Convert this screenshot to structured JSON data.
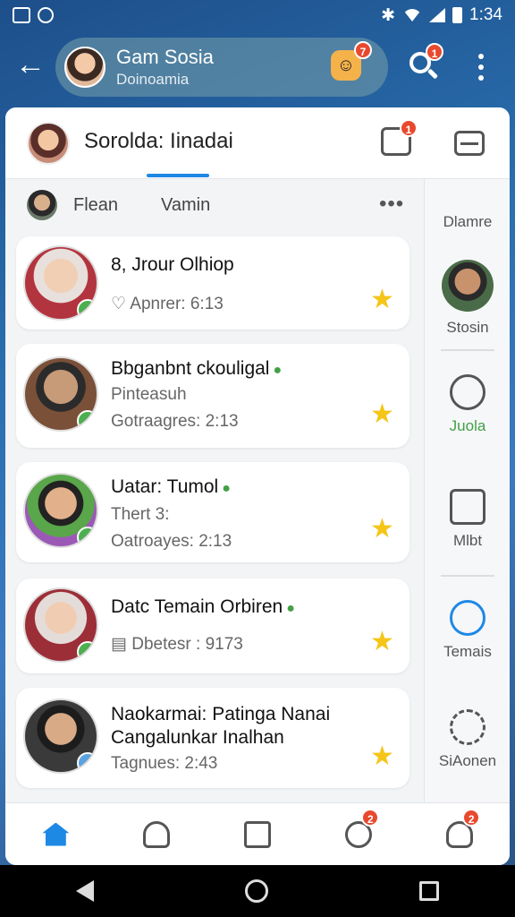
{
  "status_bar": {
    "time": "1:34"
  },
  "header": {
    "profile_name": "Gam Sosia",
    "profile_subtitle": "Doinoamia",
    "mascot_badge": "7",
    "search_badge": "1"
  },
  "card_header": {
    "title": "Sorolda: Iinadai",
    "chat_badge": "1"
  },
  "sub_tabs": [
    "Flean",
    "Vamin"
  ],
  "contacts": [
    {
      "name": "8, Jrour Olhiop",
      "line1": "Apnrer: 6:13",
      "line2": ""
    },
    {
      "name": "Bbganbnt ckouligal",
      "line1": "Pinteasuh",
      "line2": "Gotraagres: 2:13"
    },
    {
      "name": "Uatar: Tumol",
      "line1": "Thert 3:",
      "line2": "Oatroayes: 2:13"
    },
    {
      "name": "Datc Temain Orbiren",
      "line1": "Dbetesr : 9173",
      "line2": ""
    },
    {
      "name": "Naokarmai: Patinga Nanai",
      "line1": "Cangalunkar Inalhan",
      "line2": "Tagnues: 2:43"
    }
  ],
  "right_rail": [
    {
      "label": "Dlamre"
    },
    {
      "label": "Stosin"
    },
    {
      "label": "Juola"
    },
    {
      "label": "Mlbt"
    },
    {
      "label": "Temais"
    },
    {
      "label": "SiAonen"
    }
  ],
  "bottom_nav": {
    "notif_badge": "2",
    "profile_badge": "2"
  },
  "colors": {
    "accent": "#1e88e5",
    "star": "#f5c518",
    "badge": "#e8492e",
    "online": "#43a047"
  }
}
